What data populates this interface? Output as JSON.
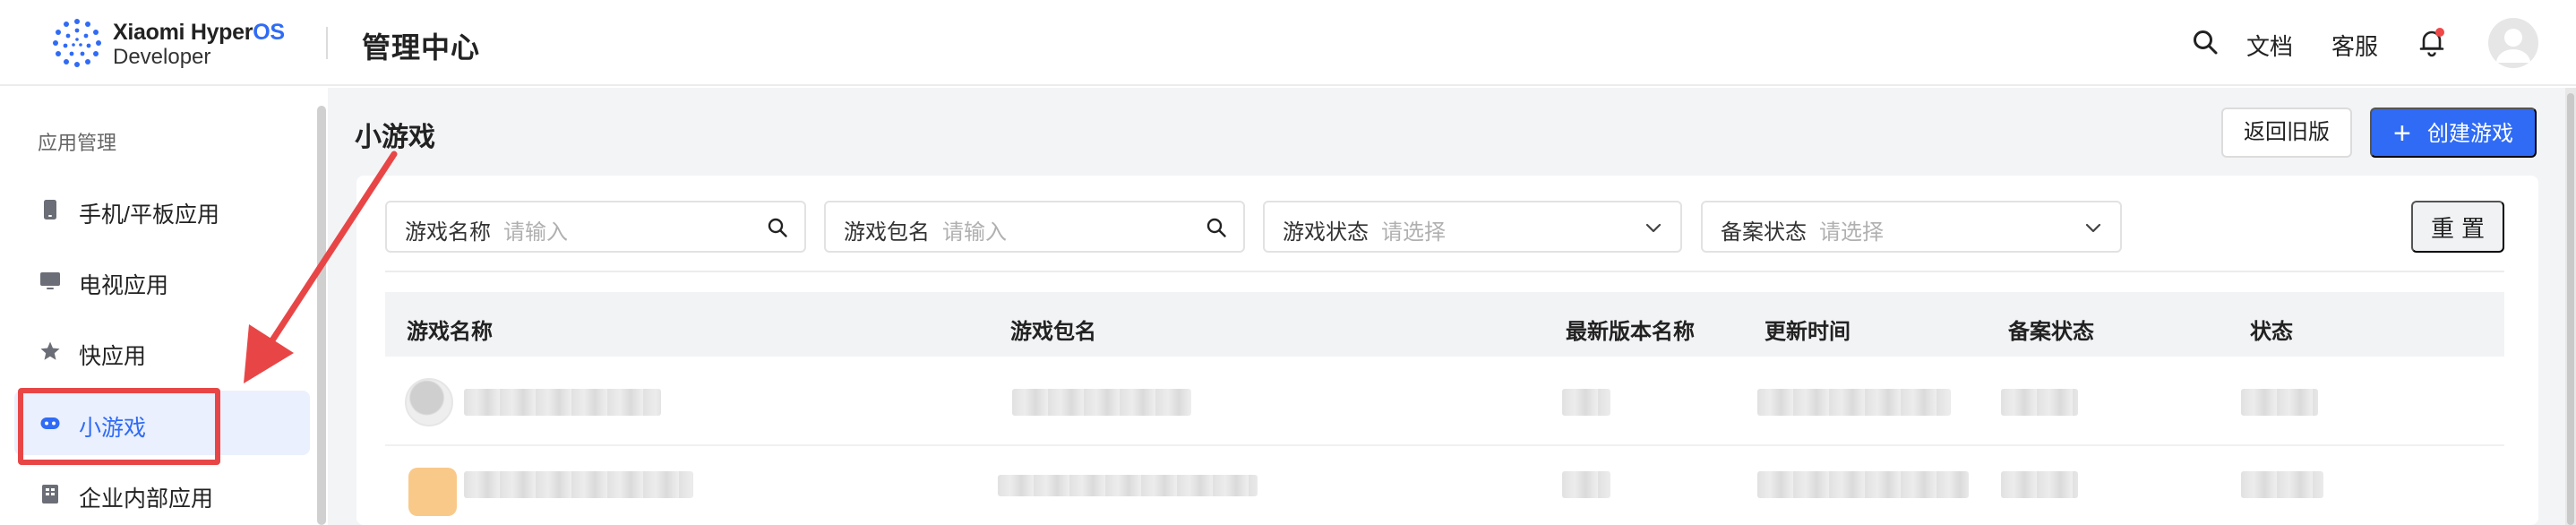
{
  "header": {
    "brand_line1_a": "Xiaomi Hyper",
    "brand_line1_b": "OS",
    "brand_line2": "Developer",
    "title": "管理中心",
    "docs_label": "文档",
    "service_label": "客服"
  },
  "sidebar": {
    "section_label": "应用管理",
    "items": [
      {
        "label": "手机/平板应用",
        "icon": "phone-icon"
      },
      {
        "label": "电视应用",
        "icon": "tv-icon"
      },
      {
        "label": "快应用",
        "icon": "star-icon"
      },
      {
        "label": "小游戏",
        "icon": "game-icon",
        "active": true
      },
      {
        "label": "企业内部应用",
        "icon": "building-icon"
      }
    ]
  },
  "page": {
    "title": "小游戏",
    "back_old_label": "返回旧版",
    "create_label": "创建游戏",
    "reset_label": "重置"
  },
  "filters": [
    {
      "label": "游戏名称",
      "placeholder": "请输入",
      "icon": "search-icon"
    },
    {
      "label": "游戏包名",
      "placeholder": "请输入",
      "icon": "search-icon"
    },
    {
      "label": "游戏状态",
      "placeholder": "请选择",
      "icon": "chevron-down-icon"
    },
    {
      "label": "备案状态",
      "placeholder": "请选择",
      "icon": "chevron-down-icon"
    }
  ],
  "table": {
    "columns": [
      "游戏名称",
      "游戏包名",
      "最新版本名称",
      "更新时间",
      "备案状态",
      "状态"
    ],
    "rows_note_blurred": true
  },
  "colors": {
    "accent": "#2f6bf5",
    "annotation": "#e84646",
    "content_bg": "#f3f4f6"
  }
}
